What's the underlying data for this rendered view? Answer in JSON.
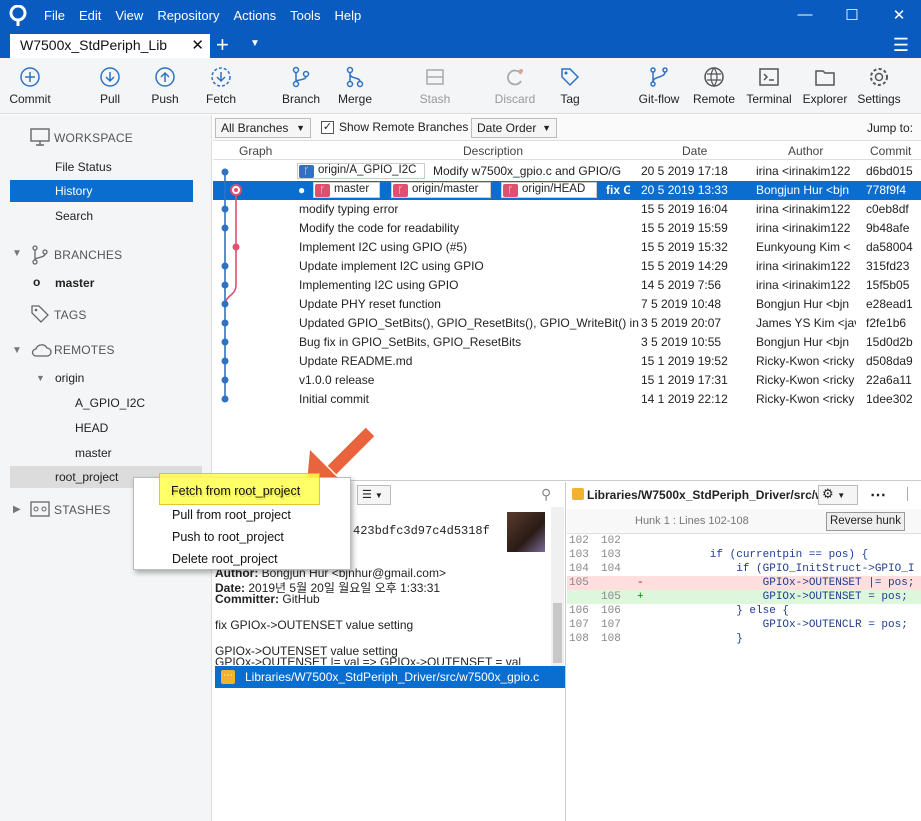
{
  "menu": [
    "File",
    "Edit",
    "View",
    "Repository",
    "Actions",
    "Tools",
    "Help"
  ],
  "tab": {
    "title": "W7500x_StdPeriph_Lib"
  },
  "toolbar": {
    "commit": "Commit",
    "pull": "Pull",
    "push": "Push",
    "fetch": "Fetch",
    "branch": "Branch",
    "merge": "Merge",
    "stash": "Stash",
    "discard": "Discard",
    "tag": "Tag",
    "gitflow": "Git-flow",
    "remote": "Remote",
    "terminal": "Terminal",
    "explorer": "Explorer",
    "settings": "Settings"
  },
  "sidebar": {
    "workspace": "WORKSPACE",
    "file_status": "File Status",
    "history": "History",
    "search": "Search",
    "branches": "BRANCHES",
    "master": "master",
    "tags": "TAGS",
    "remotes": "REMOTES",
    "origin": "origin",
    "origin_items": [
      "A_GPIO_I2C",
      "HEAD",
      "master"
    ],
    "root_project": "root_project",
    "stashes": "STASHES"
  },
  "filter": {
    "branches": "All Branches",
    "show_remote": "Show Remote Branches",
    "order": "Date Order",
    "jump": "Jump to:"
  },
  "columns": {
    "graph": "Graph",
    "description": "Description",
    "date": "Date",
    "author": "Author",
    "commit": "Commit"
  },
  "commits": [
    {
      "desc": "Modify w7500x_gpio.c  and GPIO/G",
      "date": "20 5 2019 17:18",
      "author": "irina <irinakim122",
      "hash": "d6bd015",
      "badges": [
        "origin/A_GPIO_I2C"
      ]
    },
    {
      "desc": "fix G",
      "date": "20 5 2019 13:33",
      "author": "Bongjun Hur <bjn",
      "hash": "778f9f4",
      "badges": [
        "master",
        "origin/master",
        "origin/HEAD"
      ]
    },
    {
      "desc": "modify  typing error",
      "date": "15 5 2019 16:04",
      "author": "irina <irinakim122",
      "hash": "c0eb8df"
    },
    {
      "desc": "Modify the code for readability",
      "date": "15 5 2019 15:59",
      "author": "irina <irinakim122",
      "hash": "9b48afe"
    },
    {
      "desc": "Implement I2C using GPIO (#5)",
      "date": "15 5 2019 15:32",
      "author": "Eunkyoung Kim <",
      "hash": "da58004"
    },
    {
      "desc": "Update implement I2C using GPIO",
      "date": "15 5 2019 14:29",
      "author": "irina <irinakim122",
      "hash": "315fd23"
    },
    {
      "desc": "Implementing I2C using GPIO",
      "date": "14 5 2019 7:56",
      "author": "irina <irinakim122",
      "hash": "15f5b05"
    },
    {
      "desc": "Update PHY reset function",
      "date": "7 5 2019 10:48",
      "author": "Bongjun Hur <bjn",
      "hash": "e28ead1"
    },
    {
      "desc": "Updated GPIO_SetBits(), GPIO_ResetBits(), GPIO_WriteBit() in w",
      "date": "3 5 2019 20:07",
      "author": "James YS Kim <jav",
      "hash": "f2fe1b6"
    },
    {
      "desc": "Bug fix in GPIO_SetBits, GPIO_ResetBits",
      "date": "3 5 2019 10:55",
      "author": "Bongjun Hur <bjn",
      "hash": "15d0d2b"
    },
    {
      "desc": "Update README.md",
      "date": "15 1 2019 19:52",
      "author": "Ricky-Kwon <ricky",
      "hash": "d508da9"
    },
    {
      "desc": "v1.0.0 release",
      "date": "15 1 2019 17:31",
      "author": "Ricky-Kwon <ricky",
      "hash": "22a6a11"
    },
    {
      "desc": "Initial commit",
      "date": "14 1 2019 22:12",
      "author": "Ricky-Kwon <ricky",
      "hash": "1dee302"
    }
  ],
  "details": {
    "hash_part": "423bdfc3d97c4d5318f",
    "author_label": "Author:",
    "author_value": "Bongjun Hur <bjnhur@gmail.com>",
    "date_label": "Date:",
    "date_value": "2019년 5월 20일 월요일 오후 1:33:31",
    "committer_label": "Committer:",
    "committer_value": "GitHub",
    "message1": "fix GPIOx->OUTENSET value setting",
    "message2": "GPIOx->OUTENSET value setting",
    "message3": "GPIOx->OUTENSET |= val => GPIOx->OUTENSET = val"
  },
  "file": {
    "path": "Libraries/W7500x_StdPeriph_Driver/src/w7500x_gpio.c"
  },
  "diff": {
    "header": "Libraries/W7500x_StdPeriph_Driver/src/w...",
    "hunk": "Hunk 1 : Lines 102-108",
    "reverse": "Reverse hunk",
    "lines": [
      {
        "old": "102",
        "new": "102",
        "sign": "",
        "text": ""
      },
      {
        "old": "103",
        "new": "103",
        "sign": "",
        "text": "        if (currentpin == pos) {"
      },
      {
        "old": "104",
        "new": "104",
        "sign": "",
        "text": "            if (GPIO_InitStruct->GPIO_I"
      },
      {
        "old": "105",
        "new": "",
        "sign": "-",
        "text": "                GPIOx->OUTENSET |= pos;"
      },
      {
        "old": "",
        "new": "105",
        "sign": "+",
        "text": "                GPIOx->OUTENSET = pos;"
      },
      {
        "old": "106",
        "new": "106",
        "sign": "",
        "text": "            } else {"
      },
      {
        "old": "107",
        "new": "107",
        "sign": "",
        "text": "                GPIOx->OUTENCLR = pos;"
      },
      {
        "old": "108",
        "new": "108",
        "sign": "",
        "text": "            }"
      }
    ]
  },
  "context_menu": [
    "Fetch from root_project",
    "Pull from root_project",
    "Push to root_project",
    "Delete root_project"
  ],
  "colors": {
    "accent": "#0a5bbf",
    "selection": "#0a6ed1",
    "arrow": "#e8643c",
    "highlight": "#ffff4d",
    "graph_blue": "#2f72c4",
    "graph_pink": "#e0506e"
  }
}
